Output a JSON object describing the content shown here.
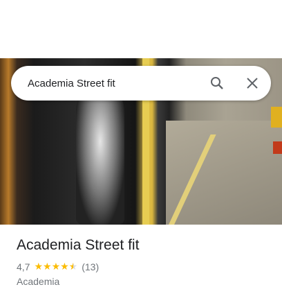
{
  "search": {
    "value": "Academia Street fit"
  },
  "place": {
    "name": "Academia Street fit",
    "rating": "4,7",
    "rating_value": 4.7,
    "stars": "★★★★",
    "half_star": "★",
    "reviews": "(13)",
    "category": "Academia"
  },
  "icons": {
    "search": "search-icon",
    "close": "close-icon"
  },
  "colors": {
    "star": "#fbbc04",
    "text": "#202124",
    "secondary": "#70757a"
  }
}
